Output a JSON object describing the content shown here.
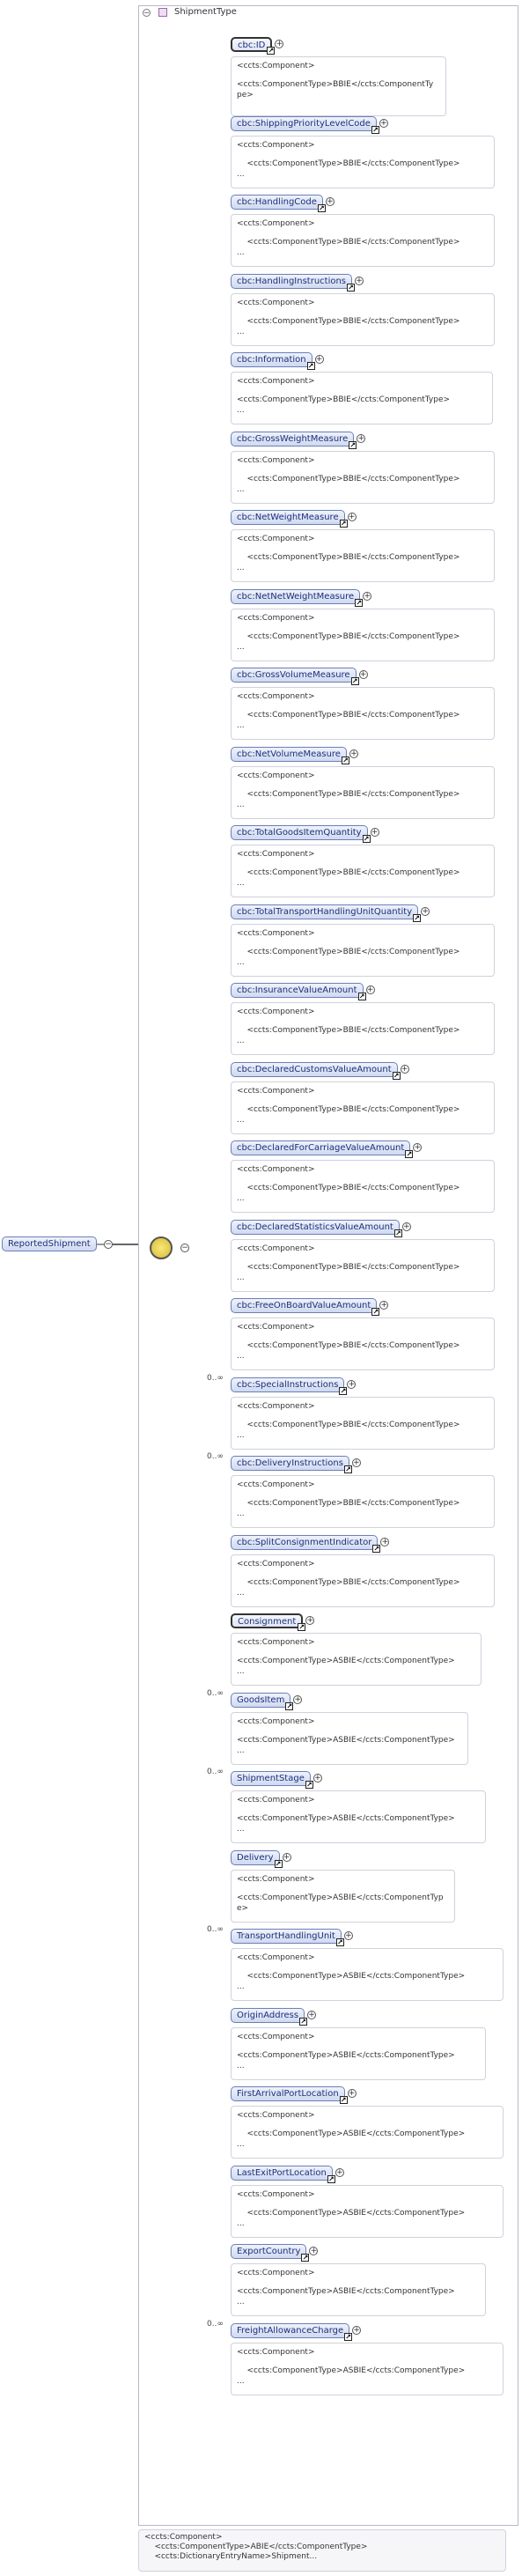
{
  "root": {
    "label": "ReportedShipment"
  },
  "group": {
    "title": "ShipmentType"
  },
  "elements": [
    {
      "label": "cbc:ID",
      "card": "",
      "doc": [
        "<ccts:Component>",
        "<ccts:ComponentType>BBIE</ccts:ComponentTy",
        "pe>"
      ],
      "sel": true
    },
    {
      "label": "cbc:ShippingPriorityLevelCode",
      "card": "",
      "doc": [
        "<ccts:Component>",
        "    <ccts:ComponentType>BBIE</ccts:ComponentType>",
        "..."
      ]
    },
    {
      "label": "cbc:HandlingCode",
      "card": "",
      "doc": [
        "<ccts:Component>",
        "    <ccts:ComponentType>BBIE</ccts:ComponentType>",
        "..."
      ]
    },
    {
      "label": "cbc:HandlingInstructions",
      "card": "",
      "doc": [
        "<ccts:Component>",
        "    <ccts:ComponentType>BBIE</ccts:ComponentType>",
        "..."
      ]
    },
    {
      "label": "cbc:Information",
      "card": "",
      "doc": [
        "<ccts:Component>",
        "<ccts:ComponentType>BBIE</ccts:ComponentType>",
        "..."
      ]
    },
    {
      "label": "cbc:GrossWeightMeasure",
      "card": "",
      "doc": [
        "<ccts:Component>",
        "    <ccts:ComponentType>BBIE</ccts:ComponentType>",
        "..."
      ]
    },
    {
      "label": "cbc:NetWeightMeasure",
      "card": "",
      "doc": [
        "<ccts:Component>",
        "    <ccts:ComponentType>BBIE</ccts:ComponentType>",
        "..."
      ]
    },
    {
      "label": "cbc:NetNetWeightMeasure",
      "card": "",
      "doc": [
        "<ccts:Component>",
        "    <ccts:ComponentType>BBIE</ccts:ComponentType>",
        "..."
      ]
    },
    {
      "label": "cbc:GrossVolumeMeasure",
      "card": "",
      "doc": [
        "<ccts:Component>",
        "    <ccts:ComponentType>BBIE</ccts:ComponentType>",
        "..."
      ]
    },
    {
      "label": "cbc:NetVolumeMeasure",
      "card": "",
      "doc": [
        "<ccts:Component>",
        "    <ccts:ComponentType>BBIE</ccts:ComponentType>",
        "..."
      ]
    },
    {
      "label": "cbc:TotalGoodsItemQuantity",
      "card": "",
      "doc": [
        "<ccts:Component>",
        "    <ccts:ComponentType>BBIE</ccts:ComponentType>",
        "..."
      ]
    },
    {
      "label": "cbc:TotalTransportHandlingUnitQuantity",
      "card": "",
      "doc": [
        "<ccts:Component>",
        "    <ccts:ComponentType>BBIE</ccts:ComponentType>",
        "..."
      ]
    },
    {
      "label": "cbc:InsuranceValueAmount",
      "card": "",
      "doc": [
        "<ccts:Component>",
        "    <ccts:ComponentType>BBIE</ccts:ComponentType>",
        "..."
      ]
    },
    {
      "label": "cbc:DeclaredCustomsValueAmount",
      "card": "",
      "doc": [
        "<ccts:Component>",
        "    <ccts:ComponentType>BBIE</ccts:ComponentType>",
        "..."
      ]
    },
    {
      "label": "cbc:DeclaredForCarriageValueAmount",
      "card": "",
      "doc": [
        "<ccts:Component>",
        "    <ccts:ComponentType>BBIE</ccts:ComponentType>",
        "..."
      ]
    },
    {
      "label": "cbc:DeclaredStatisticsValueAmount",
      "card": "",
      "doc": [
        "<ccts:Component>",
        "    <ccts:ComponentType>BBIE</ccts:ComponentType>",
        "..."
      ]
    },
    {
      "label": "cbc:FreeOnBoardValueAmount",
      "card": "",
      "doc": [
        "<ccts:Component>",
        "    <ccts:ComponentType>BBIE</ccts:ComponentType>",
        "..."
      ]
    },
    {
      "label": "cbc:SpecialInstructions",
      "card": "0..∞",
      "doc": [
        "<ccts:Component>",
        "    <ccts:ComponentType>BBIE</ccts:ComponentType>",
        "..."
      ]
    },
    {
      "label": "cbc:DeliveryInstructions",
      "card": "0..∞",
      "doc": [
        "<ccts:Component>",
        "    <ccts:ComponentType>BBIE</ccts:ComponentType>",
        "..."
      ]
    },
    {
      "label": "cbc:SplitConsignmentIndicator",
      "card": "",
      "doc": [
        "<ccts:Component>",
        "    <ccts:ComponentType>BBIE</ccts:ComponentType>",
        "..."
      ]
    },
    {
      "label": "Consignment",
      "card": "",
      "doc": [
        "<ccts:Component>",
        "<ccts:ComponentType>ASBIE</ccts:ComponentType>",
        "..."
      ],
      "sel": true
    },
    {
      "label": "GoodsItem",
      "card": "0..∞",
      "doc": [
        "<ccts:Component>",
        "<ccts:ComponentType>ASBIE</ccts:ComponentType>",
        "..."
      ]
    },
    {
      "label": "ShipmentStage",
      "card": "0..∞",
      "doc": [
        "<ccts:Component>",
        "<ccts:ComponentType>ASBIE</ccts:ComponentType>",
        "..."
      ]
    },
    {
      "label": "Delivery",
      "card": "",
      "doc": [
        "<ccts:Component>",
        "<ccts:ComponentType>ASBIE</ccts:ComponentTyp",
        "e>"
      ]
    },
    {
      "label": "TransportHandlingUnit",
      "card": "0..∞",
      "doc": [
        "<ccts:Component>",
        "    <ccts:ComponentType>ASBIE</ccts:ComponentType>",
        "..."
      ]
    },
    {
      "label": "OriginAddress",
      "card": "",
      "doc": [
        "<ccts:Component>",
        "<ccts:ComponentType>ASBIE</ccts:ComponentType>",
        "..."
      ]
    },
    {
      "label": "FirstArrivalPortLocation",
      "card": "",
      "doc": [
        "<ccts:Component>",
        "    <ccts:ComponentType>ASBIE</ccts:ComponentType>",
        "..."
      ]
    },
    {
      "label": "LastExitPortLocation",
      "card": "",
      "doc": [
        "<ccts:Component>",
        "    <ccts:ComponentType>ASBIE</ccts:ComponentType>",
        "..."
      ]
    },
    {
      "label": "ExportCountry",
      "card": "",
      "doc": [
        "<ccts:Component>",
        "<ccts:ComponentType>ASBIE</ccts:ComponentType>",
        "..."
      ]
    },
    {
      "label": "FreightAllowanceCharge",
      "card": "0..∞",
      "doc": [
        "<ccts:Component>",
        "    <ccts:ComponentType>ASBIE</ccts:ComponentType>",
        "..."
      ]
    }
  ],
  "footer": {
    "lines": [
      "<ccts:Component>",
      "    <ccts:ComponentType>ABIE</ccts:ComponentType>",
      "    <ccts:DictionaryEntryName>Shipment..."
    ]
  }
}
